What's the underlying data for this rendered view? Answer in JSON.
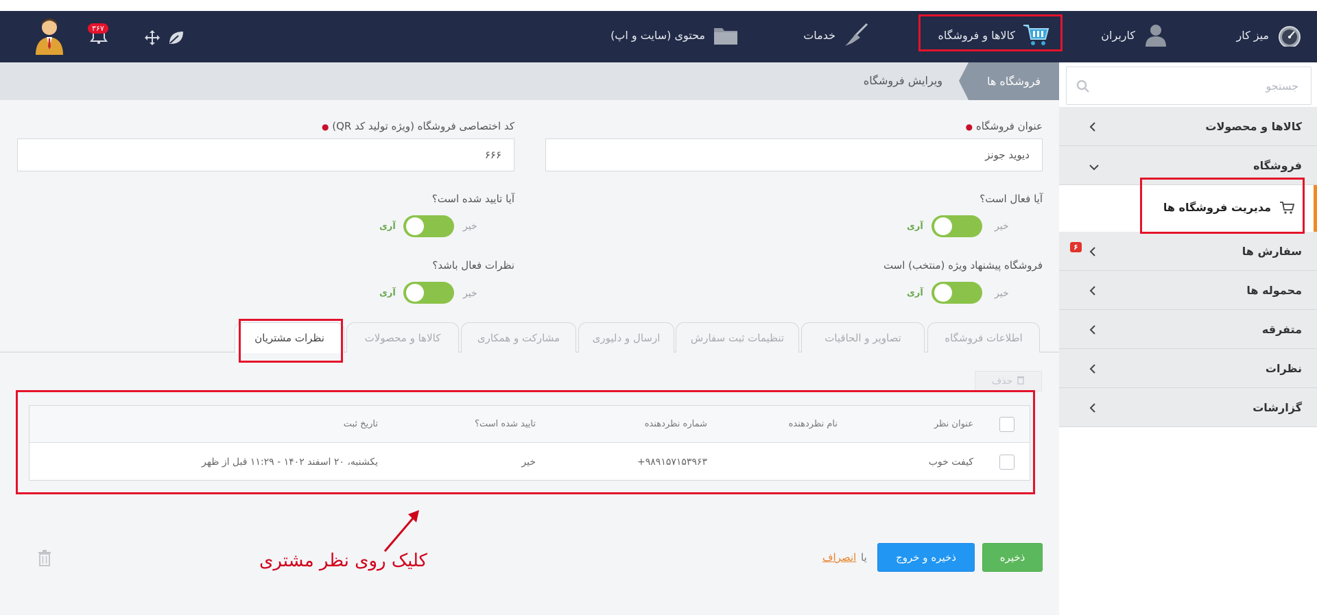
{
  "topnav": {
    "items": [
      {
        "label": "میز کار",
        "icon": "dashboard-gauge-icon"
      },
      {
        "label": "کاربران",
        "icon": "users-icon"
      },
      {
        "label": "کالاها و فروشگاه",
        "icon": "shopping-cart-icon"
      },
      {
        "label": "خدمات",
        "icon": "broom-icon"
      },
      {
        "label": "محتوی (سایت و اپ)",
        "icon": "folder-icon"
      }
    ],
    "notifications_count": "۳۶۷",
    "user_avatar": "user-avatar-icon"
  },
  "breadcrumb": {
    "root": "فروشگاه ها",
    "current": "ویرایش فروشگاه"
  },
  "sidebar": {
    "search_placeholder": "جستجو",
    "items": [
      {
        "label": "کالاها و محصولات"
      },
      {
        "label": "فروشگاه"
      },
      {
        "label": "مدیریت فروشگاه ها"
      },
      {
        "label": "سفارش ها",
        "badge": "۶"
      },
      {
        "label": "محموله ها"
      },
      {
        "label": "متفرقه"
      },
      {
        "label": "نظرات"
      },
      {
        "label": "گزارشات"
      }
    ]
  },
  "form": {
    "store_title_label": "عنوان فروشگاه",
    "store_title_value": "دیوید جونز",
    "qr_code_label": "کد اختصاصی فروشگاه (ویژه تولید کد QR)",
    "qr_code_value": "۶۶۶",
    "is_active_label": "آیا فعال است؟",
    "is_verified_label": "آیا تایید شده است؟",
    "featured_label": "فروشگاه پیشنهاد ویژه (منتخب) است",
    "comments_active_label": "نظرات فعال باشد؟",
    "toggle_no": "خیر",
    "toggle_yes": "آری"
  },
  "tabs": [
    {
      "label": "اطلاعات فروشگاه"
    },
    {
      "label": "تصاویر و الحاقیات"
    },
    {
      "label": "تنظیمات ثبت سفارش"
    },
    {
      "label": "ارسال و دلیوری"
    },
    {
      "label": "مشارکت و همکاری"
    },
    {
      "label": "کالاها و محصولات"
    },
    {
      "label": "نظرات مشتریان"
    }
  ],
  "table": {
    "delete_label": "حذف",
    "headers": [
      "عنوان نظر",
      "نام نظردهنده",
      "شماره نظردهنده",
      "تایید شده است؟",
      "تاریخ ثبت"
    ],
    "rows": [
      {
        "title": "کیفت خوب",
        "name": "",
        "phone": "+۹۸۹۱۵۷۱۵۳۹۶۳",
        "verified": "خیر",
        "date": "یکشنبه، ۲۰ اسفند ۱۴۰۲ - ۱۱:۲۹ قبل از ظهر"
      }
    ]
  },
  "actions": {
    "save": "ذخیره",
    "save_exit": "ذخیره و خروج",
    "or": "یا",
    "cancel": "انصراف"
  },
  "annotation": {
    "text": "کلیک روی نظر مشتری"
  },
  "colors": {
    "highlight": "#e4132b",
    "nav_bg": "#222b47",
    "accent_orange": "#f08a24",
    "toggle_on": "#8bc34a"
  }
}
